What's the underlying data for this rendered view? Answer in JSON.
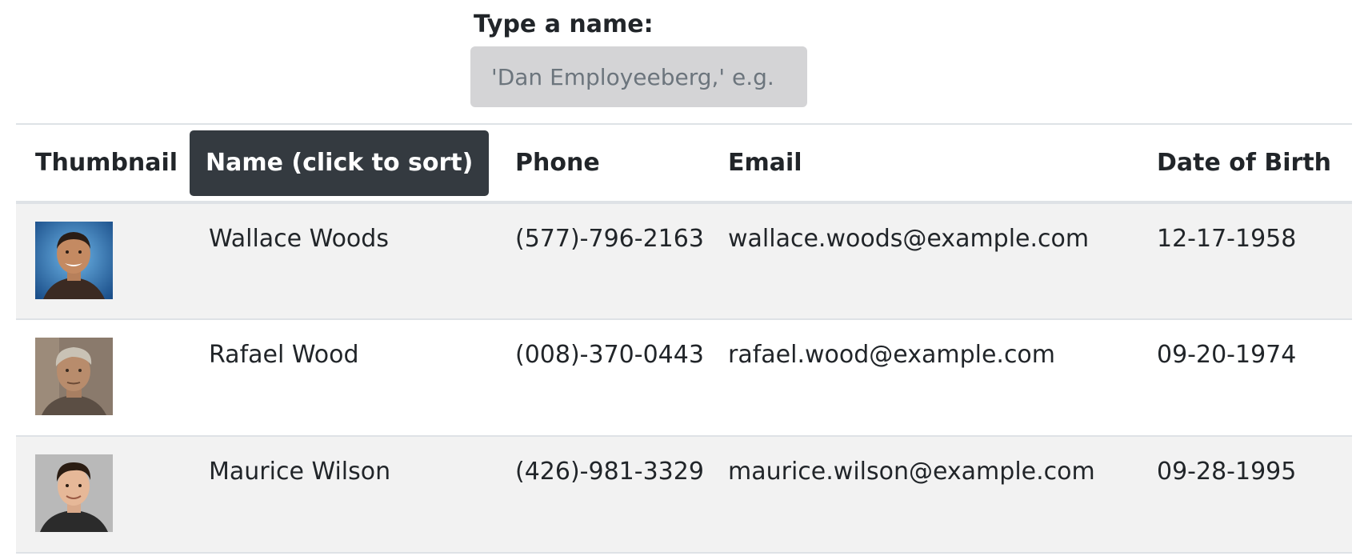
{
  "search": {
    "label": "Type a name:",
    "placeholder": "'Dan Employeeberg,' e.g.",
    "value": ""
  },
  "table": {
    "headers": {
      "thumbnail": "Thumbnail",
      "name": "Name (click to sort)",
      "phone": "Phone",
      "email": "Email",
      "dob": "Date of Birth"
    },
    "rows": [
      {
        "thumbnail": "avatar-photo",
        "name": "Wallace Woods",
        "phone": "(577)-796-2163",
        "email": "wallace.woods@example.com",
        "dob": "12-17-1958"
      },
      {
        "thumbnail": "avatar-photo",
        "name": "Rafael Wood",
        "phone": "(008)-370-0443",
        "email": "rafael.wood@example.com",
        "dob": "09-20-1974"
      },
      {
        "thumbnail": "avatar-photo",
        "name": "Maurice Wilson",
        "phone": "(426)-981-3329",
        "email": "maurice.wilson@example.com",
        "dob": "09-28-1995"
      }
    ]
  },
  "colors": {
    "sort_button_bg": "#343a40",
    "stripe_bg": "#f2f2f2",
    "input_bg": "#d4d4d6"
  }
}
